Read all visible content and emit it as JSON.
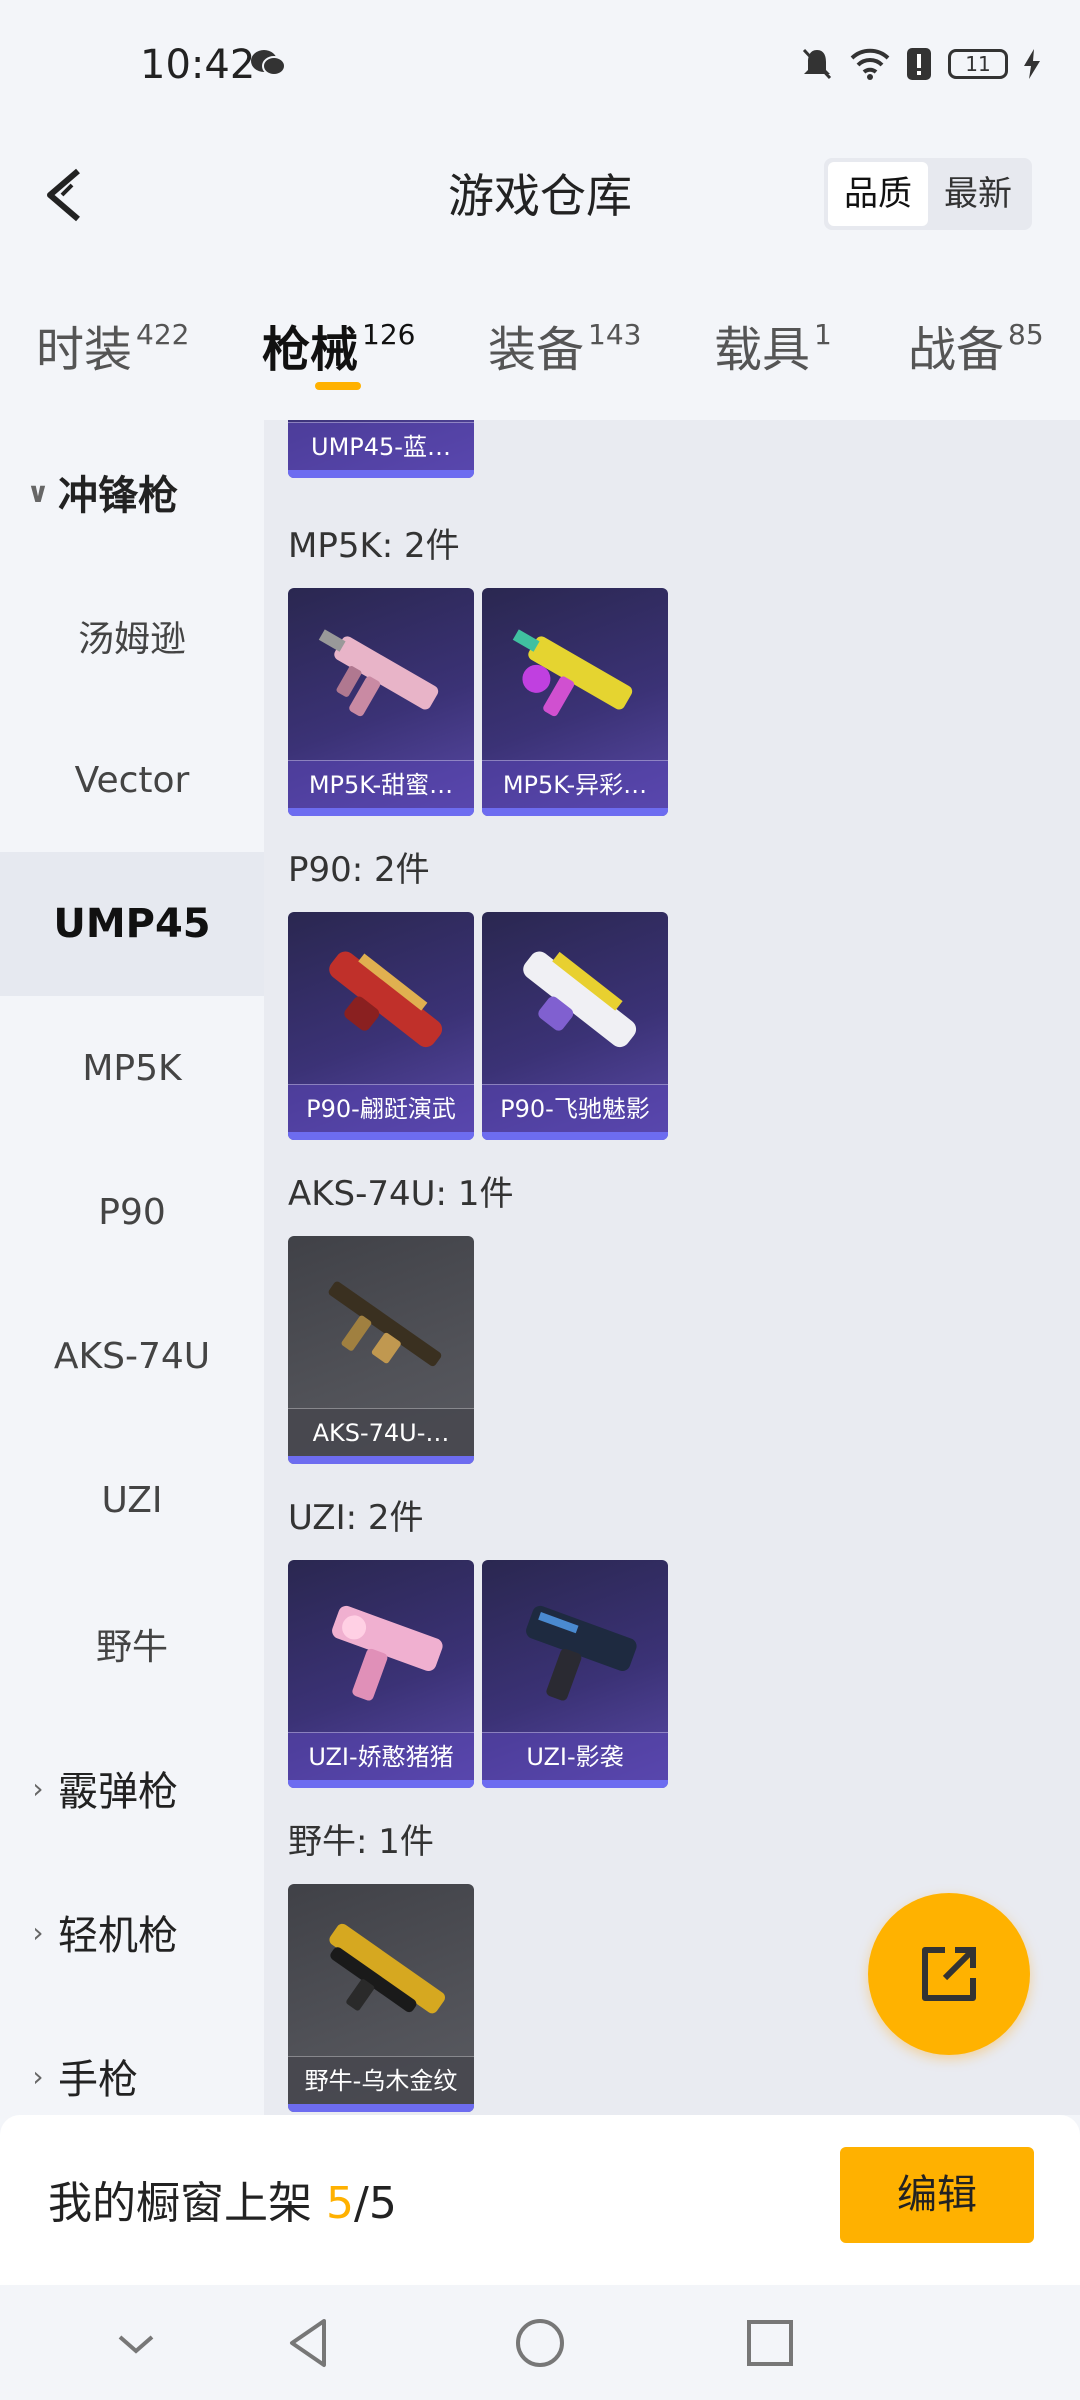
{
  "status_bar": {
    "time": "10:42",
    "battery": "11"
  },
  "header": {
    "title": "游戏仓库",
    "sort_options": [
      "品质",
      "最新"
    ],
    "active_sort": "品质"
  },
  "tabs": [
    {
      "label": "时装",
      "count": "422"
    },
    {
      "label": "枪械",
      "count": "126"
    },
    {
      "label": "装备",
      "count": "143"
    },
    {
      "label": "载具",
      "count": "1"
    },
    {
      "label": "战备",
      "count": "85"
    }
  ],
  "active_tab": "枪械",
  "sidebar": {
    "group_open": "冲锋枪",
    "items": [
      "汤姆逊",
      "Vector",
      "UMP45",
      "MP5K",
      "P90",
      "AKS-74U",
      "UZI",
      "野牛"
    ],
    "active_item": "UMP45",
    "groups_closed": [
      "霰弹枪",
      "轻机枪",
      "手枪"
    ]
  },
  "content": {
    "top_partial_card": "UMP45-蓝…",
    "sections": [
      {
        "title": "MP5K: 2件",
        "items": [
          "MP5K-甜蜜…",
          "MP5K-异彩…"
        ]
      },
      {
        "title": "P90: 2件",
        "items": [
          "P90-翩跹演武",
          "P90-飞驰魅影"
        ]
      },
      {
        "title": "AKS-74U: 1件",
        "items": [
          "AKS-74U-…"
        ]
      },
      {
        "title": "UZI: 2件",
        "items": [
          "UZI-娇憨猪猪",
          "UZI-影袭"
        ]
      },
      {
        "title": "野牛: 1件",
        "items": [
          "野牛-乌木金纹"
        ]
      }
    ]
  },
  "bottom": {
    "showcase_label": "我的橱窗上架",
    "showcase_current": "5",
    "showcase_total": "/5",
    "edit_label": "编辑"
  },
  "colors": {
    "accent": "#ffb100",
    "card_purple": "#3b3276",
    "card_gray": "#515258"
  },
  "icons": [
    "wechat-icon",
    "mute-icon",
    "wifi-icon",
    "alert-icon",
    "battery-icon",
    "charging-icon",
    "back-icon",
    "share-icon",
    "nav-back-icon",
    "nav-home-icon",
    "nav-recent-icon",
    "nav-down-icon"
  ]
}
